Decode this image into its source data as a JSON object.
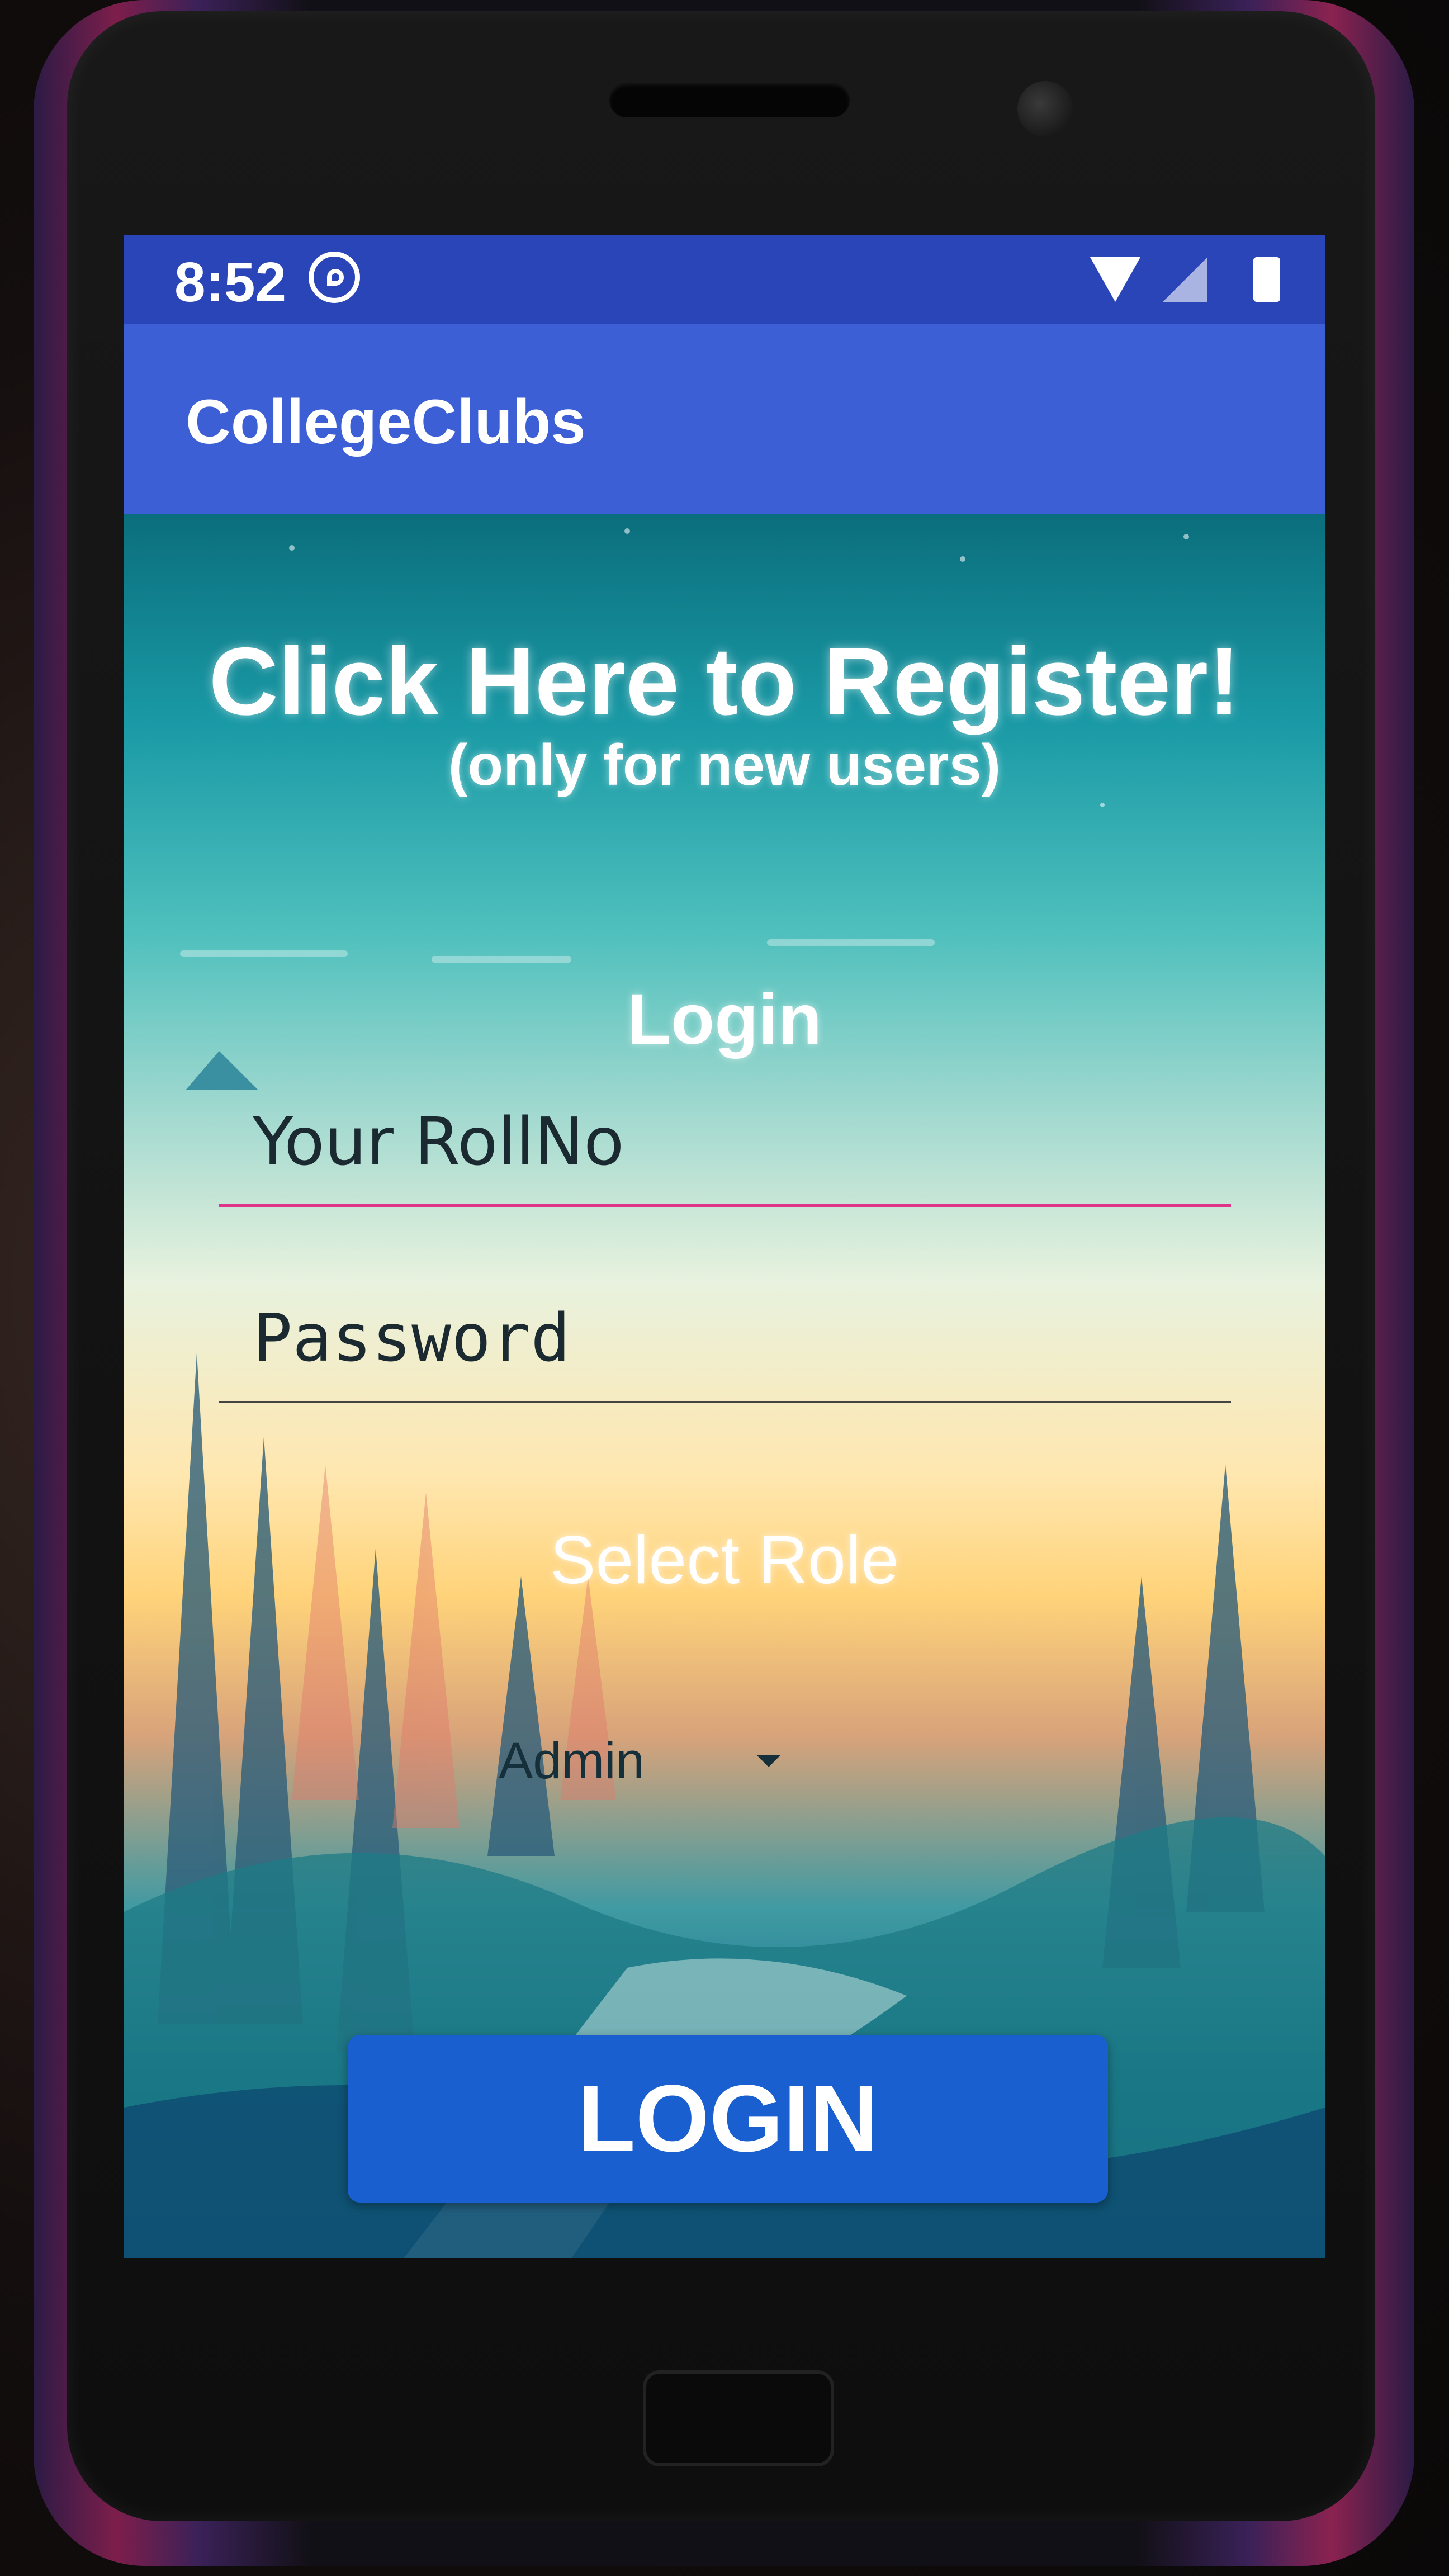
{
  "status_bar": {
    "time": "8:52"
  },
  "app_bar": {
    "title": "CollegeClubs"
  },
  "register": {
    "title": "Click Here to Register!",
    "subtitle": "(only for new users)"
  },
  "login": {
    "heading": "Login",
    "rollno_placeholder": "Your RollNo",
    "password_placeholder": "Password",
    "select_role_label": "Select Role",
    "role_selected": "Admin",
    "button_label": "LOGIN"
  },
  "colors": {
    "status_bar": "#2a45b8",
    "app_bar": "#3c5fd6",
    "accent": "#e0338a",
    "button": "#1a5fd0"
  },
  "icons": [
    "whatsapp-icon",
    "wifi-icon",
    "signal-icon",
    "battery-icon",
    "chevron-down-icon"
  ]
}
